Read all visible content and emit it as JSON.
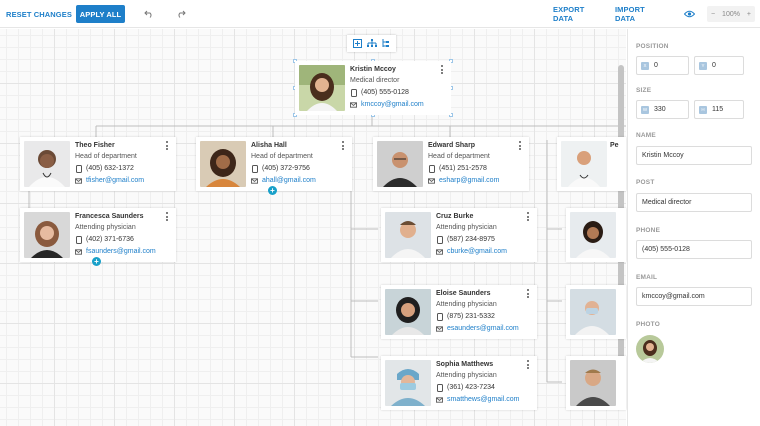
{
  "toolbar": {
    "reset_label": "RESET CHANGES",
    "apply_label": "APPLY ALL",
    "export_label": "EXPORT DATA",
    "import_label": "IMPORT DATA",
    "zoom_value": "100%",
    "zoom_minus": "−",
    "zoom_plus": "+"
  },
  "chart": {
    "director": {
      "name": "Kristin Mccoy",
      "post": "Medical director",
      "phone": "(405) 555-0128",
      "email": "kmccoy@gmail.com"
    },
    "heads": [
      {
        "name": "Theo Fisher",
        "post": "Head of department",
        "phone": "(405) 632-1372",
        "email": "tfisher@gmail.com"
      },
      {
        "name": "Alisha Hall",
        "post": "Head of department",
        "phone": "(405) 372-9756",
        "email": "ahall@gmail.com"
      },
      {
        "name": "Edward Sharp",
        "post": "Head of department",
        "phone": "(451) 251-2578",
        "email": "esharp@gmail.com"
      },
      {
        "name": "Pe",
        "post": "",
        "phone": "",
        "email": ""
      }
    ],
    "staff": [
      {
        "name": "Francesca Saunders",
        "post": "Attending physician",
        "phone": "(402) 371-6736",
        "email": "fsaunders@gmail.com"
      },
      {
        "name": "Cruz Burke",
        "post": "Attending physician",
        "phone": "(587) 234-8975",
        "email": "cburke@gmail.com"
      },
      {
        "name": "Eloise Saunders",
        "post": "Attending physician",
        "phone": "(875) 231-5332",
        "email": "esaunders@gmail.com"
      },
      {
        "name": "Sophia Matthews",
        "post": "Attending physician",
        "phone": "(361) 423-7234",
        "email": "smatthews@gmail.com"
      }
    ]
  },
  "panel": {
    "position_label": "POSITION",
    "x_tag": "X",
    "x_value": "0",
    "y_tag": "Y",
    "y_value": "0",
    "size_label": "SIZE",
    "w_tag": "W",
    "w_value": "330",
    "h_tag": "H",
    "h_value": "115",
    "name_label": "NAME",
    "name_value": "Kristin Mccoy",
    "post_label": "POST",
    "post_value": "Medical director",
    "phone_label": "PHONE",
    "phone_value": "(405) 555-0128",
    "email_label": "EMAIL",
    "email_value": "kmccoy@gmail.com",
    "photo_label": "PHOTO"
  },
  "colors": {
    "accent": "#1e7fc9",
    "plus": "#18a0c9"
  }
}
